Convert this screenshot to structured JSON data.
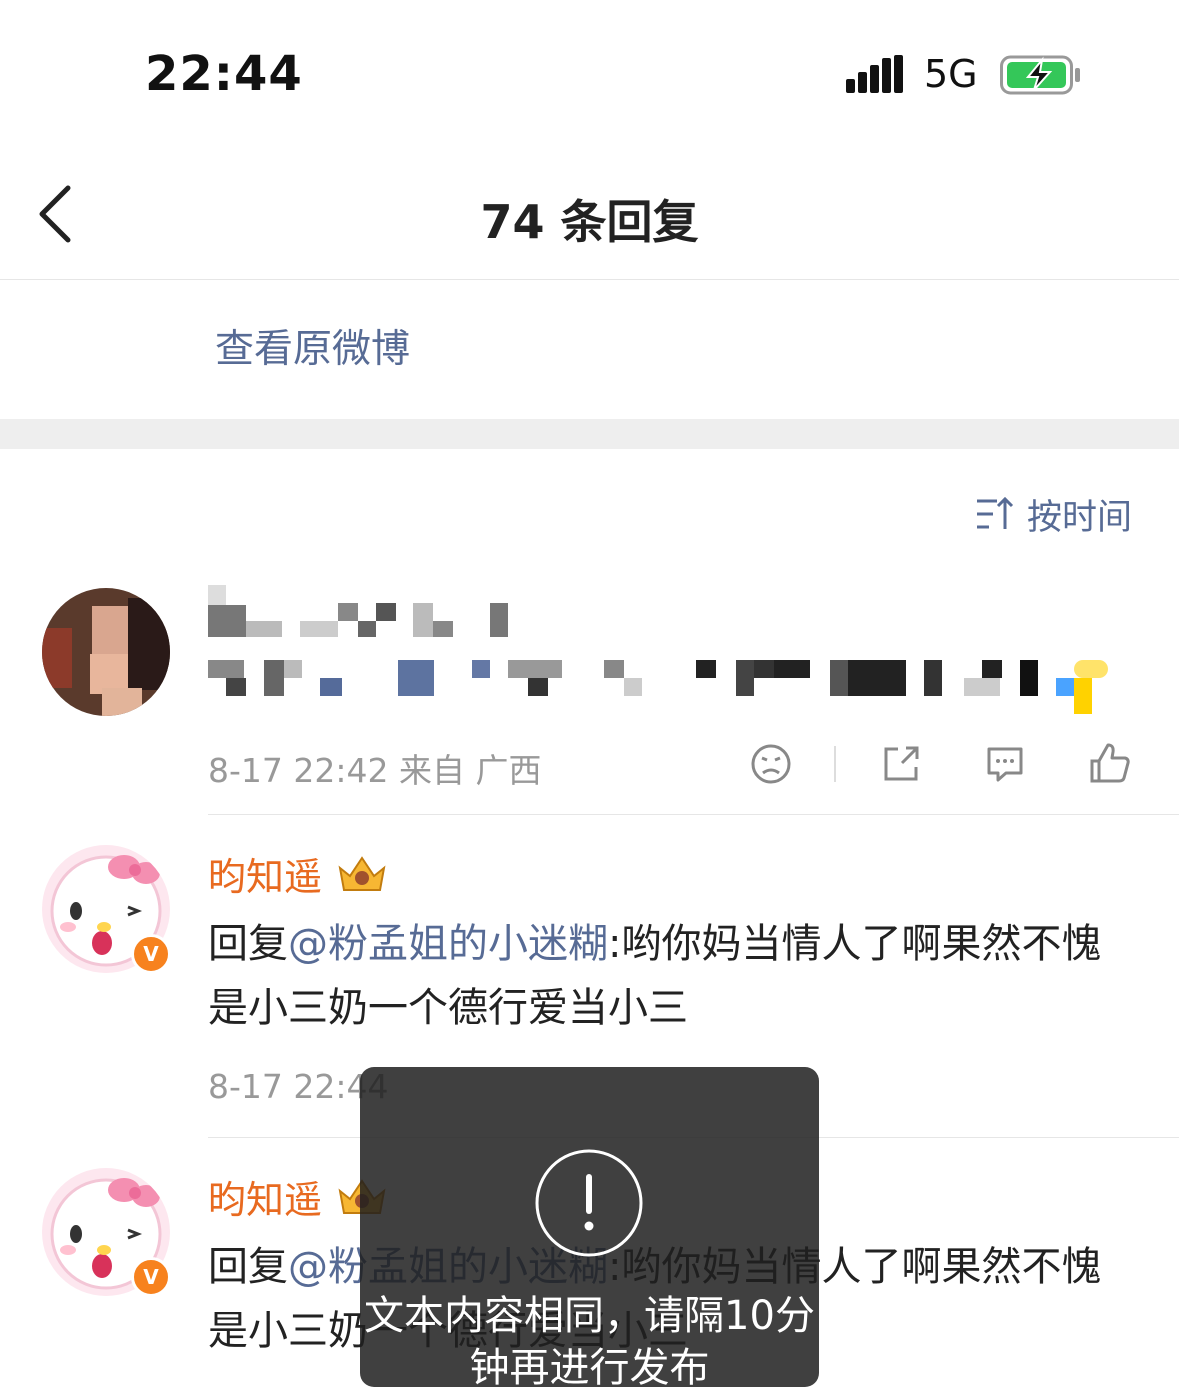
{
  "status_bar": {
    "time": "22:44",
    "network": "5G"
  },
  "nav": {
    "title": "74 条回复"
  },
  "view_original": "查看原微博",
  "sort": {
    "label": "按时间"
  },
  "main_comment": {
    "meta": "8-17 22:42 来自 广西"
  },
  "replies": [
    {
      "name": "昀知遥",
      "prefix": "回复",
      "mention": "@粉孟姐的小迷糊",
      "text": ":哟你妈当情人了啊果然不愧是小三奶一个德行爱当小三",
      "meta": "8-17 22:44"
    },
    {
      "name": "昀知遥",
      "prefix": "回复",
      "mention": "@粉孟姐的小迷糊",
      "text": ":哟你妈当情人了啊果然不愧是小三奶一个德行爱当小三"
    }
  ],
  "toast": {
    "text": "文本内容相同，请隔10分钟再进行发布"
  },
  "colors": {
    "link": "#576b95",
    "username": "#e86a20",
    "battery": "#34c759"
  },
  "icons": [
    "signal-icon",
    "battery-charging-icon",
    "back-chevron-icon",
    "sort-icon",
    "sad-face-icon",
    "share-icon",
    "comment-icon",
    "like-icon",
    "crown-badge-icon",
    "verified-badge-icon",
    "alert-icon"
  ]
}
